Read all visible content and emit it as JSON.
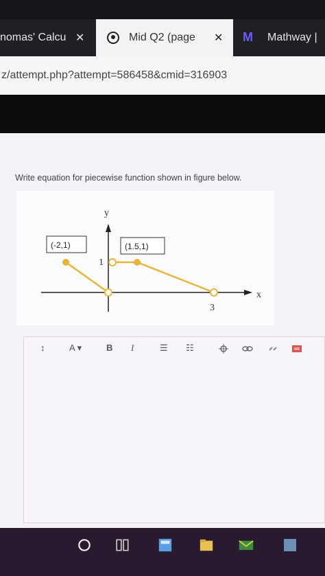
{
  "browser": {
    "tabs": [
      {
        "label": "nomas' Calcu",
        "close": "✕"
      },
      {
        "label": "Mid Q2 (page",
        "close": "✕"
      },
      {
        "label": "Mathway |",
        "icon": "M"
      }
    ],
    "url": "z/attempt.php?attempt=586458&cmid=316903"
  },
  "question": {
    "text": "Write equation for piecewise function shown in figure below."
  },
  "figure": {
    "y_axis_label": "y",
    "x_axis_label": "x",
    "point_left_label": "(-2,1)",
    "point_right_label": "(1.5,1)",
    "y_tick_label": "1",
    "x_tick_label": "3"
  },
  "editor_toolbar": {
    "paragraph": "↕",
    "font": "A ▾",
    "bold": "B",
    "italic": "I",
    "bullets": "☰",
    "numbered": "☷"
  },
  "colors": {
    "accent": "#e8b53a",
    "tab_active": "#f3f3f6",
    "page_bg": "#f4f1f7"
  }
}
